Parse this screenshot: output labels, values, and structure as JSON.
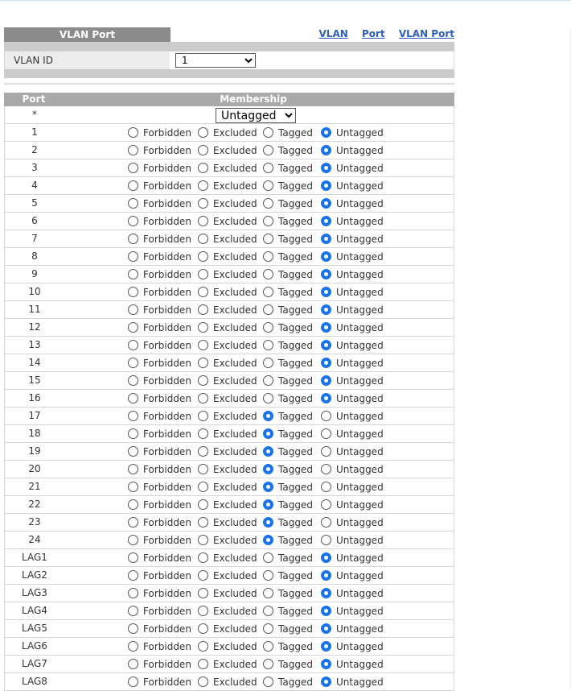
{
  "page": {
    "title": "VLAN Port",
    "nav_links": [
      "VLAN",
      "Port",
      "VLAN Port"
    ]
  },
  "vlan_id": {
    "label": "VLAN ID",
    "selected": "1"
  },
  "table": {
    "col_port": "Port",
    "col_membership": "Membership",
    "all_row": {
      "port": "*",
      "selected": "Untagged"
    },
    "options": [
      "Forbidden",
      "Excluded",
      "Tagged",
      "Untagged"
    ],
    "rows": [
      {
        "port": "1",
        "membership": "Untagged"
      },
      {
        "port": "2",
        "membership": "Untagged"
      },
      {
        "port": "3",
        "membership": "Untagged"
      },
      {
        "port": "4",
        "membership": "Untagged"
      },
      {
        "port": "5",
        "membership": "Untagged"
      },
      {
        "port": "6",
        "membership": "Untagged"
      },
      {
        "port": "7",
        "membership": "Untagged"
      },
      {
        "port": "8",
        "membership": "Untagged"
      },
      {
        "port": "9",
        "membership": "Untagged"
      },
      {
        "port": "10",
        "membership": "Untagged"
      },
      {
        "port": "11",
        "membership": "Untagged"
      },
      {
        "port": "12",
        "membership": "Untagged"
      },
      {
        "port": "13",
        "membership": "Untagged"
      },
      {
        "port": "14",
        "membership": "Untagged"
      },
      {
        "port": "15",
        "membership": "Untagged"
      },
      {
        "port": "16",
        "membership": "Untagged"
      },
      {
        "port": "17",
        "membership": "Tagged"
      },
      {
        "port": "18",
        "membership": "Tagged"
      },
      {
        "port": "19",
        "membership": "Tagged"
      },
      {
        "port": "20",
        "membership": "Tagged"
      },
      {
        "port": "21",
        "membership": "Tagged"
      },
      {
        "port": "22",
        "membership": "Tagged"
      },
      {
        "port": "23",
        "membership": "Tagged"
      },
      {
        "port": "24",
        "membership": "Tagged"
      },
      {
        "port": "LAG1",
        "membership": "Untagged"
      },
      {
        "port": "LAG2",
        "membership": "Untagged"
      },
      {
        "port": "LAG3",
        "membership": "Untagged"
      },
      {
        "port": "LAG4",
        "membership": "Untagged"
      },
      {
        "port": "LAG5",
        "membership": "Untagged"
      },
      {
        "port": "LAG6",
        "membership": "Untagged"
      },
      {
        "port": "LAG7",
        "membership": "Untagged"
      },
      {
        "port": "LAG8",
        "membership": "Untagged"
      }
    ]
  },
  "colors": {
    "title_bg": "#8b8b8b",
    "header_bg": "#a9a9a9",
    "link": "#2d60b6",
    "radio_selected": "#1a73e8"
  }
}
